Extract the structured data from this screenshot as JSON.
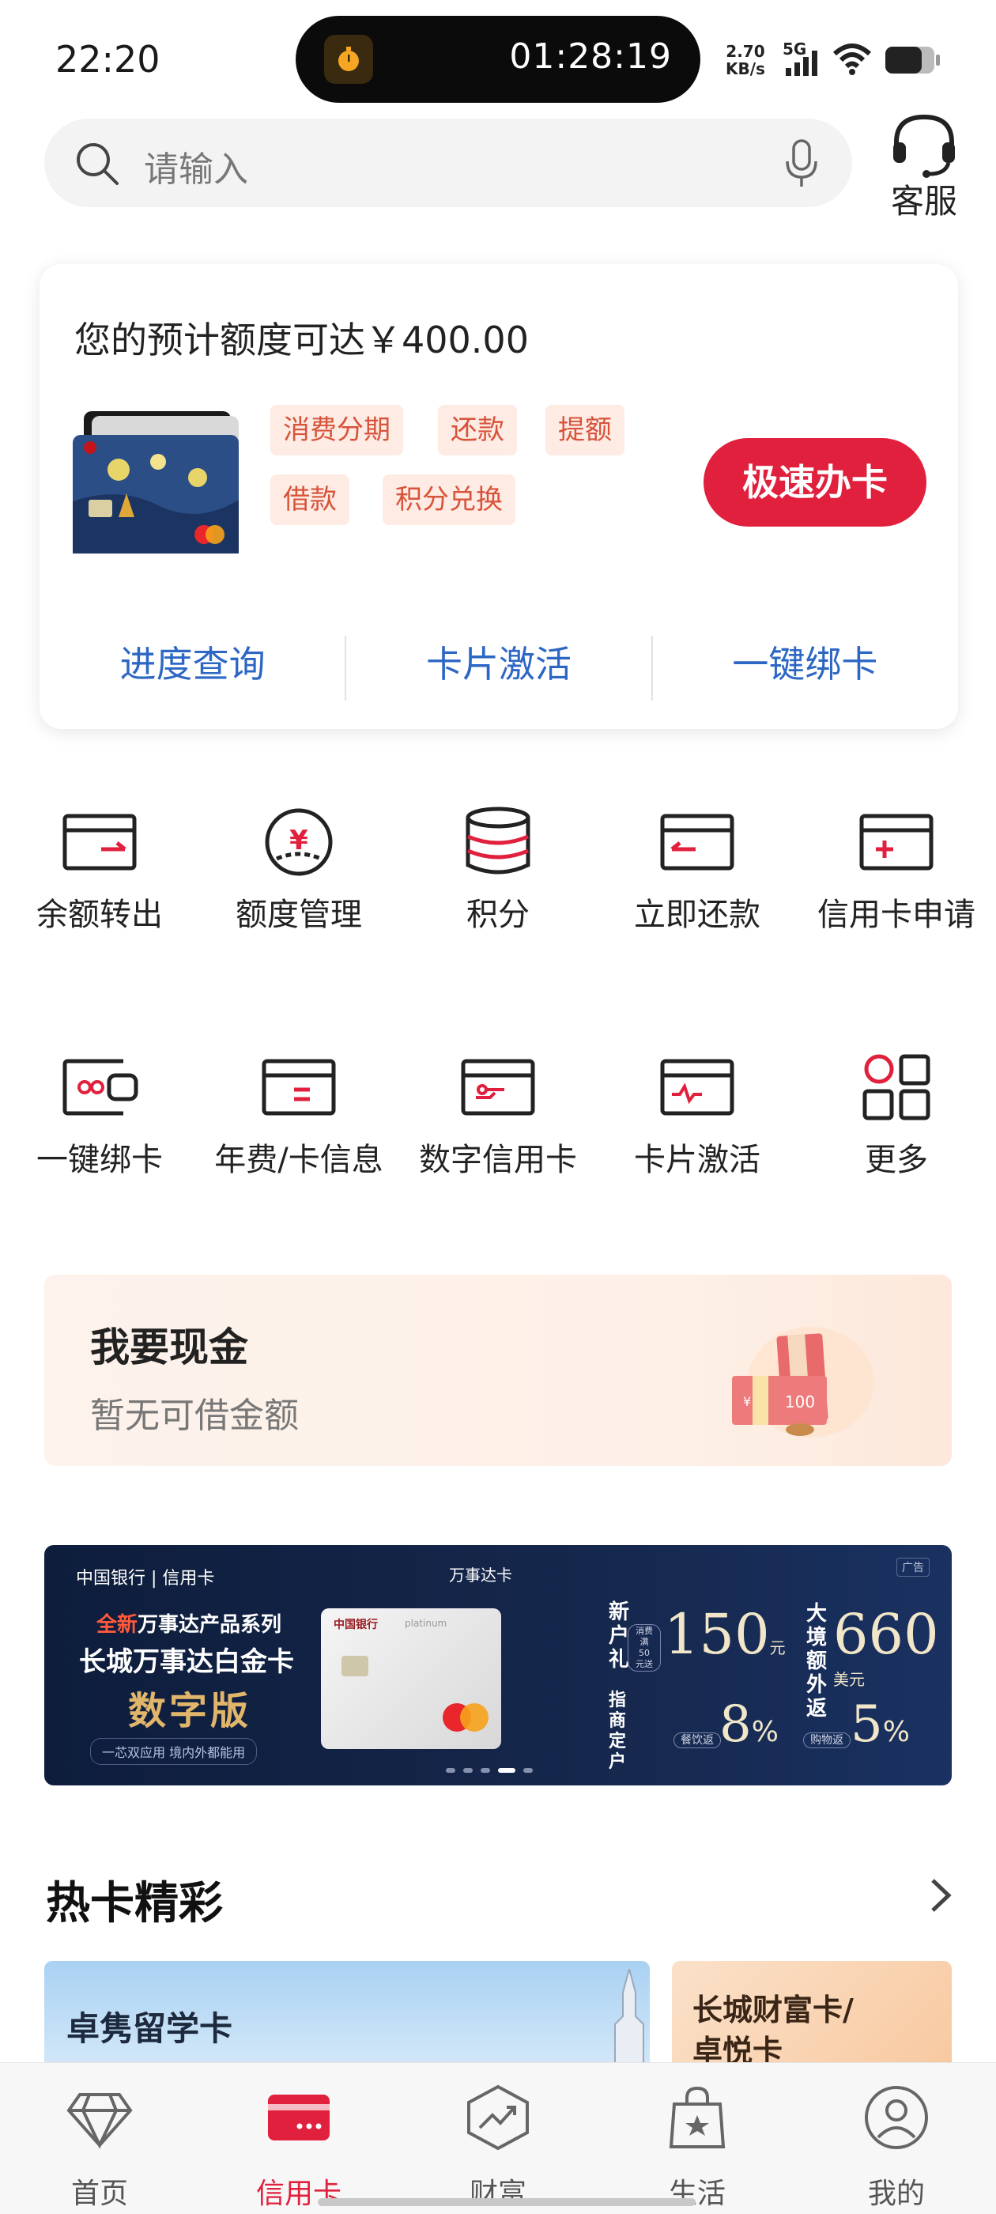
{
  "status_bar": {
    "time": "22:20",
    "timer": "01:28:19",
    "net_speed_value": "2.70",
    "net_speed_unit": "KB/s",
    "network": "5G"
  },
  "search": {
    "placeholder": "请输入",
    "service_label": "客服"
  },
  "credit_panel": {
    "title": "您的预计额度可达￥400.00",
    "tags": [
      "消费分期",
      "还款",
      "提额",
      "借款",
      "积分兑换"
    ],
    "apply_button": "极速办卡",
    "quick_links": [
      "进度查询",
      "卡片激活",
      "一键绑卡"
    ]
  },
  "grid": {
    "row1": [
      "余额转出",
      "额度管理",
      "积分",
      "立即还款",
      "信用卡申请"
    ],
    "row2": [
      "一键绑卡",
      "年费/卡信息",
      "数字信用卡",
      "卡片激活",
      "更多"
    ]
  },
  "cash": {
    "title": "我要现金",
    "subtitle": "暂无可借金额"
  },
  "ad": {
    "bank": "中国银行 | 信用卡",
    "mastercard": "万事达卡",
    "ad_tag": "广告",
    "highlight": "全新",
    "series": "万事达产品系列",
    "card_name": "长城万事达白金卡",
    "edition": "数字版",
    "slogan": "一芯双应用 境内外都能用",
    "card_brand": "中国银行",
    "card_level": "platinum",
    "gift_label": "新户礼",
    "gift_condition": "消费满50元送",
    "gift_amount": "150",
    "gift_unit": "元",
    "cashback_label": "大境额外返",
    "cashback_amount": "660",
    "cashback_unit": "美元",
    "merchant_label": "指商定户",
    "dining_tag": "餐饮返",
    "dining_rate": "8",
    "shopping_tag": "购物返",
    "shopping_rate": "5",
    "percent": "%"
  },
  "hot_cards": {
    "title": "热卡精彩",
    "card1": "卓隽留学卡",
    "card2_line1": "长城财富卡/",
    "card2_line2": "卓悦卡"
  },
  "tab_bar": {
    "tabs": [
      "首页",
      "信用卡",
      "财富",
      "生活",
      "我的"
    ],
    "active": "信用卡"
  },
  "colors": {
    "accent_red": "#e0203d",
    "link_blue": "#2d67c4",
    "tag_text": "#d8533a",
    "tag_bg": "#fdebe4"
  }
}
